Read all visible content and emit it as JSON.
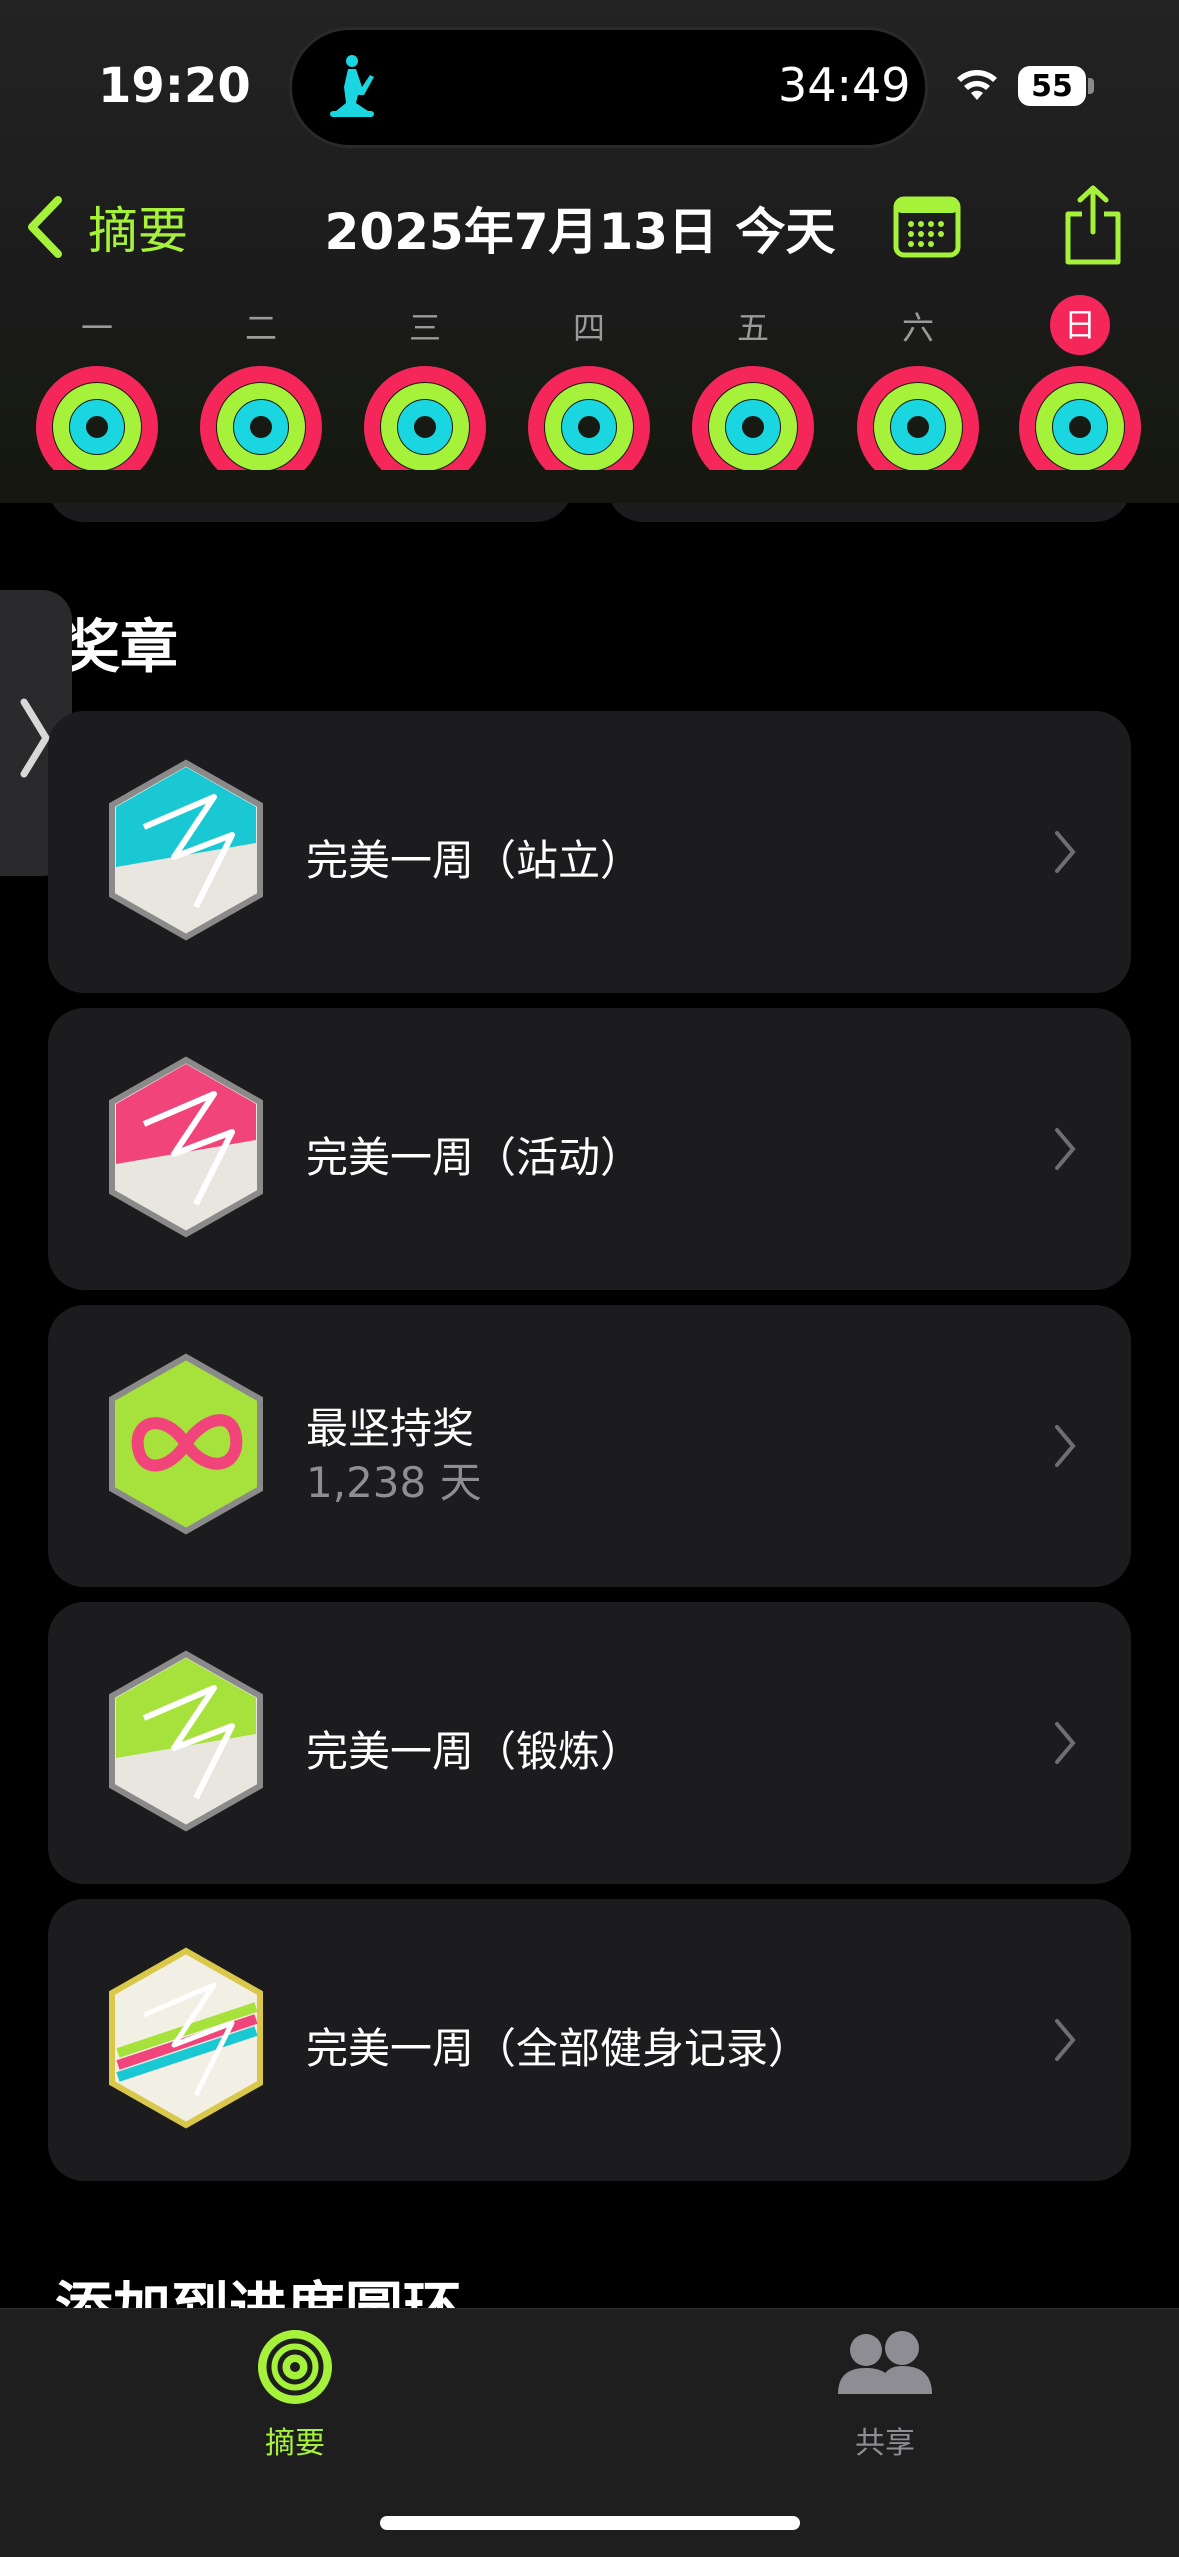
{
  "status_bar": {
    "time": "19:20",
    "timer": "34:49",
    "battery": "55"
  },
  "nav": {
    "back_label": "摘要",
    "title": "2025年7月13日 今天"
  },
  "week": {
    "days": [
      "一",
      "二",
      "三",
      "四",
      "五",
      "六",
      "日"
    ],
    "today_index": 6
  },
  "awards": {
    "section_title": "奖章",
    "items": [
      {
        "title": "完美一周（站立）",
        "subtitle": "",
        "badge": "perfect-week-stand"
      },
      {
        "title": "完美一周（活动）",
        "subtitle": "",
        "badge": "perfect-week-move"
      },
      {
        "title": "最坚持奖",
        "subtitle": "1,238 天",
        "badge": "longest-streak"
      },
      {
        "title": "完美一周（锻炼）",
        "subtitle": "",
        "badge": "perfect-week-exercise"
      },
      {
        "title": "完美一周（全部健身记录）",
        "subtitle": "",
        "badge": "perfect-week-all"
      }
    ]
  },
  "next_section_title": "添加到进度圆环",
  "tab_bar": {
    "summary_label": "摘要",
    "sharing_label": "共享"
  },
  "colors": {
    "accent": "#a6f23b",
    "move": "#f5265a",
    "exercise": "#a6f23b",
    "stand": "#19d6e0",
    "card": "#1c1c1e"
  }
}
